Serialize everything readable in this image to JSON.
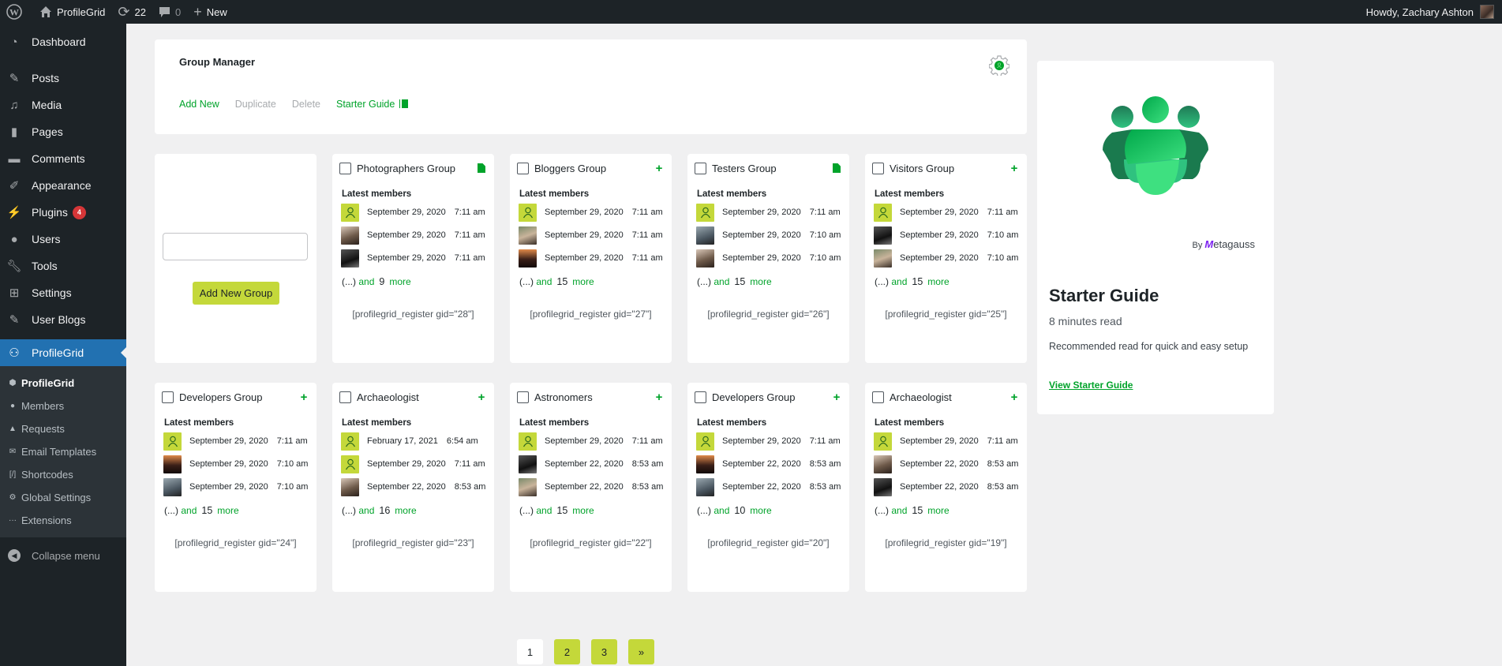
{
  "adminbar": {
    "site_name": "ProfileGrid",
    "updates_count": "22",
    "comments_count": "0",
    "new_label": "New",
    "greeting": "Howdy, Zachary Ashton"
  },
  "sidebar": {
    "items": [
      {
        "label": "Dashboard",
        "icon": "dashboard-icon"
      },
      {
        "label": "Posts",
        "icon": "pin-icon"
      },
      {
        "label": "Media",
        "icon": "media-icon"
      },
      {
        "label": "Pages",
        "icon": "pages-icon"
      },
      {
        "label": "Comments",
        "icon": "comment-icon"
      },
      {
        "label": "Appearance",
        "icon": "brush-icon"
      },
      {
        "label": "Plugins",
        "icon": "plugin-icon",
        "badge": "4"
      },
      {
        "label": "Users",
        "icon": "user-icon"
      },
      {
        "label": "Tools",
        "icon": "wrench-icon"
      },
      {
        "label": "Settings",
        "icon": "settings-icon"
      },
      {
        "label": "User Blogs",
        "icon": "pin-icon"
      }
    ],
    "current": {
      "label": "ProfileGrid",
      "icon": "groups-icon"
    },
    "submenu": [
      {
        "label": "ProfileGrid"
      },
      {
        "label": "Members"
      },
      {
        "label": "Requests"
      },
      {
        "label": "Email Templates"
      },
      {
        "label": "Shortcodes"
      },
      {
        "label": "Global Settings"
      },
      {
        "label": "Extensions"
      }
    ],
    "collapse_label": "Collapse menu"
  },
  "header": {
    "title": "Group Manager",
    "actions": {
      "add_new": "Add New",
      "duplicate": "Duplicate",
      "delete": "Delete",
      "starter_guide": "Starter Guide"
    }
  },
  "new_group": {
    "input_value": "",
    "button_label": "Add New Group"
  },
  "labels": {
    "latest_members": "Latest members",
    "ellipsis": "(...)",
    "and": "and",
    "more": "more"
  },
  "groups": [
    {
      "name": "Photographers Group",
      "icon": "doc",
      "members": [
        {
          "date": "September 29, 2020",
          "time": "7:11 am",
          "avatar": "default"
        },
        {
          "date": "September 29, 2020",
          "time": "7:11 am",
          "avatar": "photo"
        },
        {
          "date": "September 29, 2020",
          "time": "7:11 am",
          "avatar": "photo"
        }
      ],
      "more_count": "9",
      "shortcode": "[profilegrid_register gid=\"28\"]"
    },
    {
      "name": "Bloggers Group",
      "icon": "plus",
      "members": [
        {
          "date": "September 29, 2020",
          "time": "7:11 am",
          "avatar": "default"
        },
        {
          "date": "September 29, 2020",
          "time": "7:11 am",
          "avatar": "photo"
        },
        {
          "date": "September 29, 2020",
          "time": "7:11 am",
          "avatar": "photo"
        }
      ],
      "more_count": "15",
      "shortcode": "[profilegrid_register gid=\"27\"]"
    },
    {
      "name": "Testers Group",
      "icon": "doc",
      "members": [
        {
          "date": "September 29, 2020",
          "time": "7:11 am",
          "avatar": "default"
        },
        {
          "date": "September 29, 2020",
          "time": "7:10 am",
          "avatar": "photo"
        },
        {
          "date": "September 29, 2020",
          "time": "7:10 am",
          "avatar": "photo"
        }
      ],
      "more_count": "15",
      "shortcode": "[profilegrid_register gid=\"26\"]"
    },
    {
      "name": "Visitors Group",
      "icon": "plus",
      "members": [
        {
          "date": "September 29, 2020",
          "time": "7:11 am",
          "avatar": "default"
        },
        {
          "date": "September 29, 2020",
          "time": "7:10 am",
          "avatar": "photo"
        },
        {
          "date": "September 29, 2020",
          "time": "7:10 am",
          "avatar": "photo"
        }
      ],
      "more_count": "15",
      "shortcode": "[profilegrid_register gid=\"25\"]"
    },
    {
      "name": "Developers Group",
      "icon": "plus",
      "members": [
        {
          "date": "September 29, 2020",
          "time": "7:11 am",
          "avatar": "default"
        },
        {
          "date": "September 29, 2020",
          "time": "7:10 am",
          "avatar": "photo"
        },
        {
          "date": "September 29, 2020",
          "time": "7:10 am",
          "avatar": "photo"
        }
      ],
      "more_count": "15",
      "shortcode": "[profilegrid_register gid=\"24\"]"
    },
    {
      "name": "Archaeologist",
      "icon": "plus",
      "members": [
        {
          "date": "February 17, 2021",
          "time": "6:54 am",
          "avatar": "default"
        },
        {
          "date": "September 29, 2020",
          "time": "7:11 am",
          "avatar": "default"
        },
        {
          "date": "September 22, 2020",
          "time": "8:53 am",
          "avatar": "photo"
        }
      ],
      "more_count": "16",
      "shortcode": "[profilegrid_register gid=\"23\"]"
    },
    {
      "name": "Astronomers",
      "icon": "plus",
      "members": [
        {
          "date": "September 29, 2020",
          "time": "7:11 am",
          "avatar": "default"
        },
        {
          "date": "September 22, 2020",
          "time": "8:53 am",
          "avatar": "photo"
        },
        {
          "date": "September 22, 2020",
          "time": "8:53 am",
          "avatar": "photo"
        }
      ],
      "more_count": "15",
      "shortcode": "[profilegrid_register gid=\"22\"]"
    },
    {
      "name": "Developers Group",
      "icon": "plus",
      "members": [
        {
          "date": "September 29, 2020",
          "time": "7:11 am",
          "avatar": "default"
        },
        {
          "date": "September 22, 2020",
          "time": "8:53 am",
          "avatar": "photo"
        },
        {
          "date": "September 22, 2020",
          "time": "8:53 am",
          "avatar": "photo"
        }
      ],
      "more_count": "10",
      "shortcode": "[profilegrid_register gid=\"20\"]"
    },
    {
      "name": "Archaeologist",
      "icon": "plus",
      "members": [
        {
          "date": "September 29, 2020",
          "time": "7:11 am",
          "avatar": "default"
        },
        {
          "date": "September 22, 2020",
          "time": "8:53 am",
          "avatar": "photo"
        },
        {
          "date": "September 22, 2020",
          "time": "8:53 am",
          "avatar": "photo"
        }
      ],
      "more_count": "15",
      "shortcode": "[profilegrid_register gid=\"19\"]"
    }
  ],
  "pagination": {
    "pages": [
      "1",
      "2",
      "3",
      "»"
    ],
    "current": "1"
  },
  "starter_guide": {
    "by_label": "By",
    "brand_m": "M",
    "brand_rest": "etagauss",
    "title": "Starter Guide",
    "read_time": "8 minutes read",
    "description": "Recommended read for quick and easy setup",
    "link_label": "View Starter Guide"
  },
  "colors": {
    "accent_green": "#00a32a",
    "lime": "#c4d83a",
    "wp_blue": "#2271b1",
    "admin_dark": "#1d2327"
  }
}
